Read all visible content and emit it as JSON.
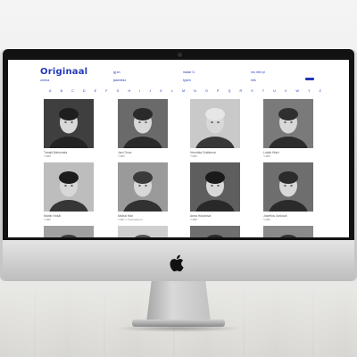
{
  "site": {
    "logo": "Originaal",
    "nav": [
      {
        "label": "gj.sn"
      },
      {
        "label": "riadar !1"
      },
      {
        "label": "mú riter pl"
      },
      {
        "label": "umbra"
      },
      {
        "label": "jaarviekz"
      },
      {
        "label": "typen"
      },
      {
        "label": "info"
      }
    ],
    "alphabet": [
      "A",
      "B",
      "C",
      "D",
      "E",
      "F",
      "G",
      "H",
      "I",
      "J",
      "K",
      "L",
      "M",
      "N",
      "O",
      "P",
      "Q",
      "R",
      "S",
      "T",
      "U",
      "V",
      "W",
      "Y",
      "Z"
    ]
  },
  "people": [
    {
      "name": "Tomáš Bártovaka",
      "year": "*1988",
      "tone": "#3f3f3f",
      "hair": "#1e1e1e"
    },
    {
      "name": "Jan Chruz",
      "year": "*1986",
      "tone": "#6a6a6a",
      "hair": "#2a2a2a"
    },
    {
      "name": "Veronika Drábková",
      "year": "*1986",
      "tone": "#c9c9c9",
      "hair": "#e6e6e6"
    },
    {
      "name": "Lukáš Hlaví",
      "year": "*1985",
      "tone": "#7a7a7a",
      "hair": "#2f2f2f"
    },
    {
      "name": "Martin Holub",
      "year": "*1986",
      "tone": "#bdbdbd",
      "hair": "#1c1c1c"
    },
    {
      "name": "Michal Hán",
      "year": "*1987 v Prachaticích",
      "tone": "#9a9a9a",
      "hair": "#3a3a3a"
    },
    {
      "name": "Anna Holubová",
      "year": "*1988",
      "tone": "#5e5e5e",
      "hair": "#1a1a1a"
    },
    {
      "name": "Josefína Junková",
      "year": "*1986",
      "tone": "#6e6e6e",
      "hair": "#2b2b2b"
    },
    {
      "name": "",
      "year": "",
      "tone": "#a0a0a0",
      "hair": "#3a3a3a"
    },
    {
      "name": "",
      "year": "",
      "tone": "#cfcfcf",
      "hair": "#555555"
    },
    {
      "name": "",
      "year": "",
      "tone": "#6f6f6f",
      "hair": "#2a2a2a"
    },
    {
      "name": "",
      "year": "",
      "tone": "#8a8a8a",
      "hair": "#333333"
    }
  ]
}
